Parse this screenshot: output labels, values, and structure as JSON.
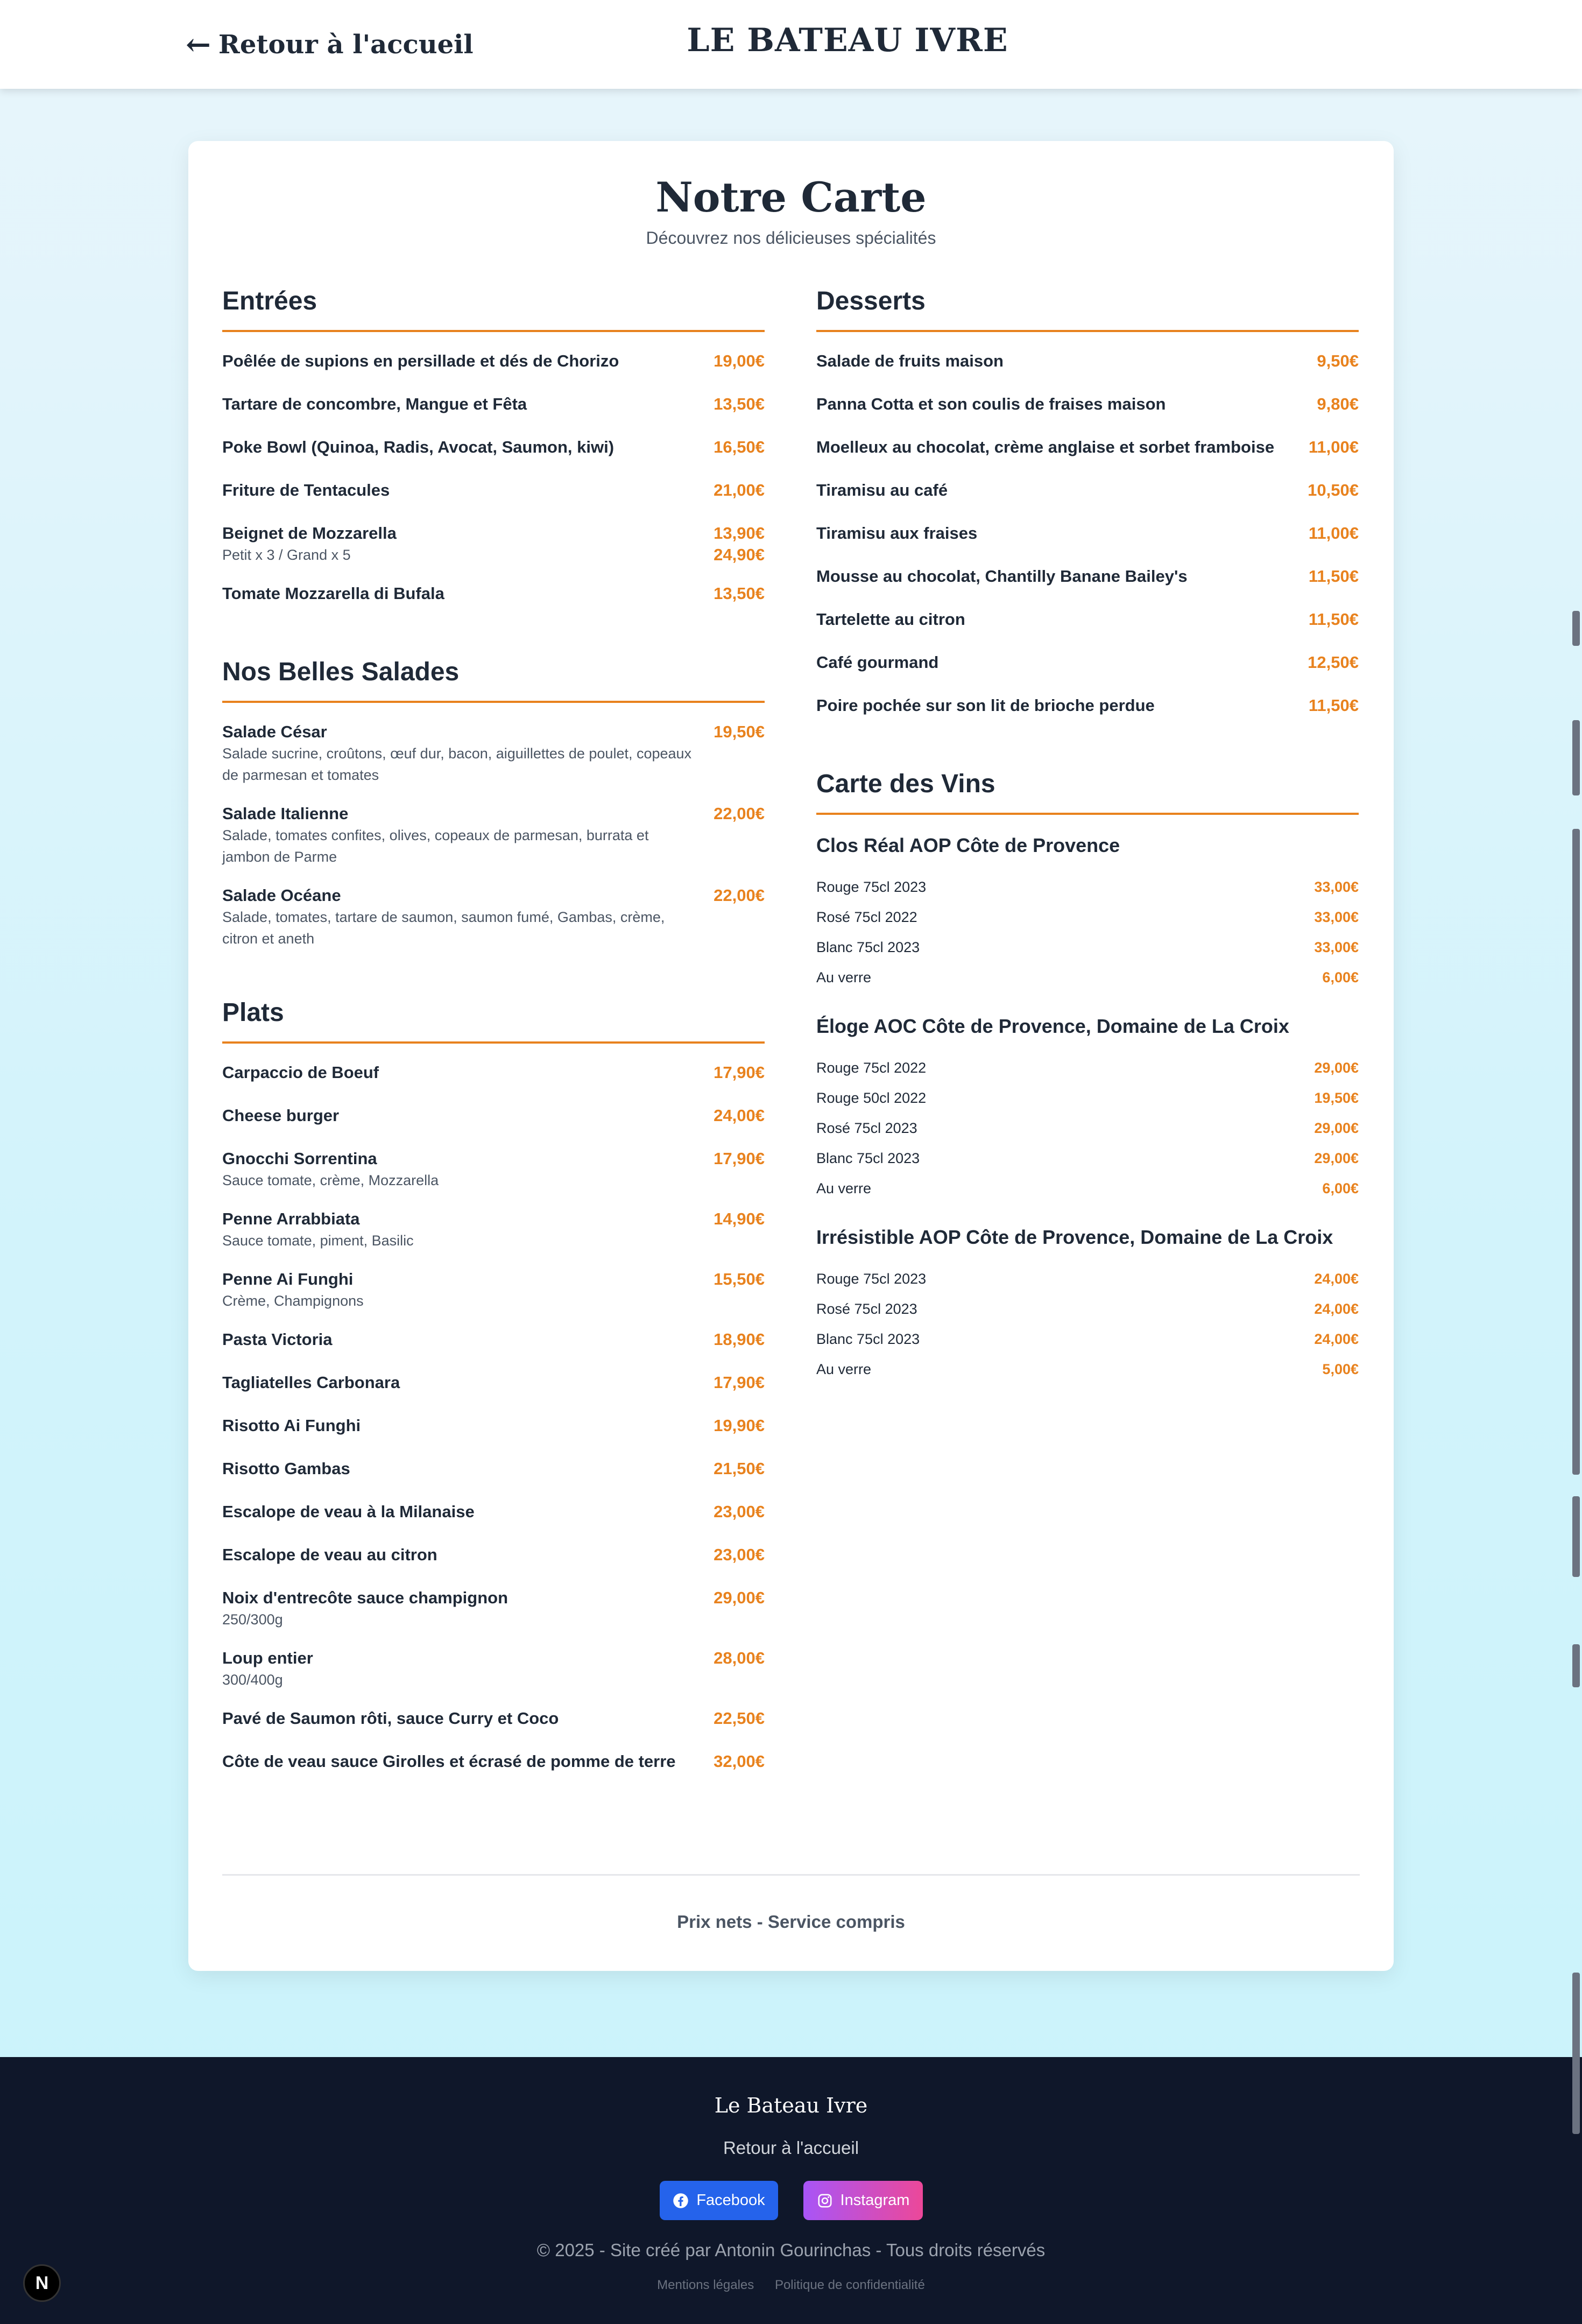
{
  "header": {
    "back_label": "Retour à l'accueil",
    "brand": "LE BATEAU IVRE"
  },
  "card": {
    "title": "Notre Carte",
    "subtitle": "Découvrez nos délicieuses spécialités",
    "footnote": "Prix nets - Service compris"
  },
  "sections": {
    "entrees": {
      "title": "Entrées",
      "items": [
        {
          "name": "Poêlée de supions en persillade et dés de Chorizo",
          "price": "19,00€"
        },
        {
          "name": "Tartare de concombre, Mangue et Fêta",
          "price": "13,50€"
        },
        {
          "name": "Poke Bowl (Quinoa, Radis, Avocat, Saumon, kiwi)",
          "price": "16,50€"
        },
        {
          "name": "Friture de Tentacules",
          "price": "21,00€"
        },
        {
          "name": "Beignet de Mozzarella",
          "desc": "Petit x 3 / Grand x 5",
          "price": "13,90€",
          "price2": "24,90€"
        },
        {
          "name": "Tomate Mozzarella di Bufala",
          "price": "13,50€"
        }
      ]
    },
    "salades": {
      "title": "Nos Belles Salades",
      "items": [
        {
          "name": "Salade César",
          "desc": "Salade sucrine, croûtons, œuf dur, bacon, aiguillettes de poulet, copeaux de parmesan et tomates",
          "price": "19,50€"
        },
        {
          "name": "Salade Italienne",
          "desc": "Salade, tomates confites, olives, copeaux de parmesan, burrata et jambon de Parme",
          "price": "22,00€"
        },
        {
          "name": "Salade Océane",
          "desc": "Salade, tomates, tartare de saumon, saumon fumé, Gambas, crème, citron et aneth",
          "price": "22,00€"
        }
      ]
    },
    "plats": {
      "title": "Plats",
      "items": [
        {
          "name": "Carpaccio de Boeuf",
          "price": "17,90€"
        },
        {
          "name": "Cheese burger",
          "price": "24,00€"
        },
        {
          "name": "Gnocchi Sorrentina",
          "desc": "Sauce tomate, crème, Mozzarella",
          "price": "17,90€"
        },
        {
          "name": "Penne Arrabbiata",
          "desc": "Sauce tomate, piment, Basilic",
          "price": "14,90€"
        },
        {
          "name": "Penne Ai Funghi",
          "desc": "Crème, Champignons",
          "price": "15,50€"
        },
        {
          "name": "Pasta Victoria",
          "price": "18,90€"
        },
        {
          "name": "Tagliatelles Carbonara",
          "price": "17,90€"
        },
        {
          "name": "Risotto Ai Funghi",
          "price": "19,90€"
        },
        {
          "name": "Risotto Gambas",
          "price": "21,50€"
        },
        {
          "name": "Escalope de veau à la Milanaise",
          "price": "23,00€"
        },
        {
          "name": "Escalope de veau au citron",
          "price": "23,00€"
        },
        {
          "name": "Noix d'entrecôte sauce champignon",
          "desc": "250/300g",
          "price": "29,00€"
        },
        {
          "name": "Loup entier",
          "desc": "300/400g",
          "price": "28,00€"
        },
        {
          "name": "Pavé de Saumon rôti, sauce Curry et Coco",
          "price": "22,50€"
        },
        {
          "name": "Côte de veau sauce Girolles et écrasé de pomme de terre",
          "price": "32,00€"
        }
      ]
    },
    "desserts": {
      "title": "Desserts",
      "items": [
        {
          "name": "Salade de fruits maison",
          "price": "9,50€"
        },
        {
          "name": "Panna Cotta et son coulis de fraises maison",
          "price": "9,80€"
        },
        {
          "name": "Moelleux au chocolat, crème anglaise et sorbet framboise",
          "price": "11,00€"
        },
        {
          "name": "Tiramisu au café",
          "price": "10,50€"
        },
        {
          "name": "Tiramisu aux fraises",
          "price": "11,00€"
        },
        {
          "name": "Mousse au chocolat, Chantilly Banane Bailey's",
          "price": "11,50€"
        },
        {
          "name": "Tartelette au citron",
          "price": "11,50€"
        },
        {
          "name": "Café gourmand",
          "price": "12,50€"
        },
        {
          "name": "Poire pochée sur son lit de brioche perdue",
          "price": "11,50€"
        }
      ]
    },
    "vins": {
      "title": "Carte des Vins",
      "wines": [
        {
          "name": "Clos Réal AOP Côte de Provence",
          "rows": [
            {
              "label": "Rouge 75cl 2023",
              "price": "33,00€"
            },
            {
              "label": "Rosé 75cl 2022",
              "price": "33,00€"
            },
            {
              "label": "Blanc 75cl 2023",
              "price": "33,00€"
            },
            {
              "label": "Au verre",
              "price": "6,00€"
            }
          ]
        },
        {
          "name": "Éloge AOC Côte de Provence, Domaine de La Croix",
          "rows": [
            {
              "label": "Rouge 75cl 2022",
              "price": "29,00€"
            },
            {
              "label": "Rouge 50cl 2022",
              "price": "19,50€"
            },
            {
              "label": "Rosé 75cl 2023",
              "price": "29,00€"
            },
            {
              "label": "Blanc 75cl 2023",
              "price": "29,00€"
            },
            {
              "label": "Au verre",
              "price": "6,00€"
            }
          ]
        },
        {
          "name": "Irrésistible AOP Côte de Provence, Domaine de La Croix",
          "rows": [
            {
              "label": "Rouge 75cl 2023",
              "price": "24,00€"
            },
            {
              "label": "Rosé 75cl 2023",
              "price": "24,00€"
            },
            {
              "label": "Blanc 75cl 2023",
              "price": "24,00€"
            },
            {
              "label": "Au verre",
              "price": "5,00€"
            }
          ]
        }
      ]
    }
  },
  "footer": {
    "brand": "Le Bateau Ivre",
    "home_link": "Retour à l'accueil",
    "facebook": "Facebook",
    "instagram": "Instagram",
    "copyright": "© 2025 - Site créé par Antonin Gourinchas - Tous droits réservés",
    "legal": "Mentions légales",
    "privacy": "Politique de confidentialité"
  },
  "badge": "N",
  "colors": {
    "accent": "#e8821e",
    "footer_bg": "#0f172a",
    "facebook": "#2563eb",
    "instagram_from": "#a855f7",
    "instagram_to": "#ec4899"
  }
}
